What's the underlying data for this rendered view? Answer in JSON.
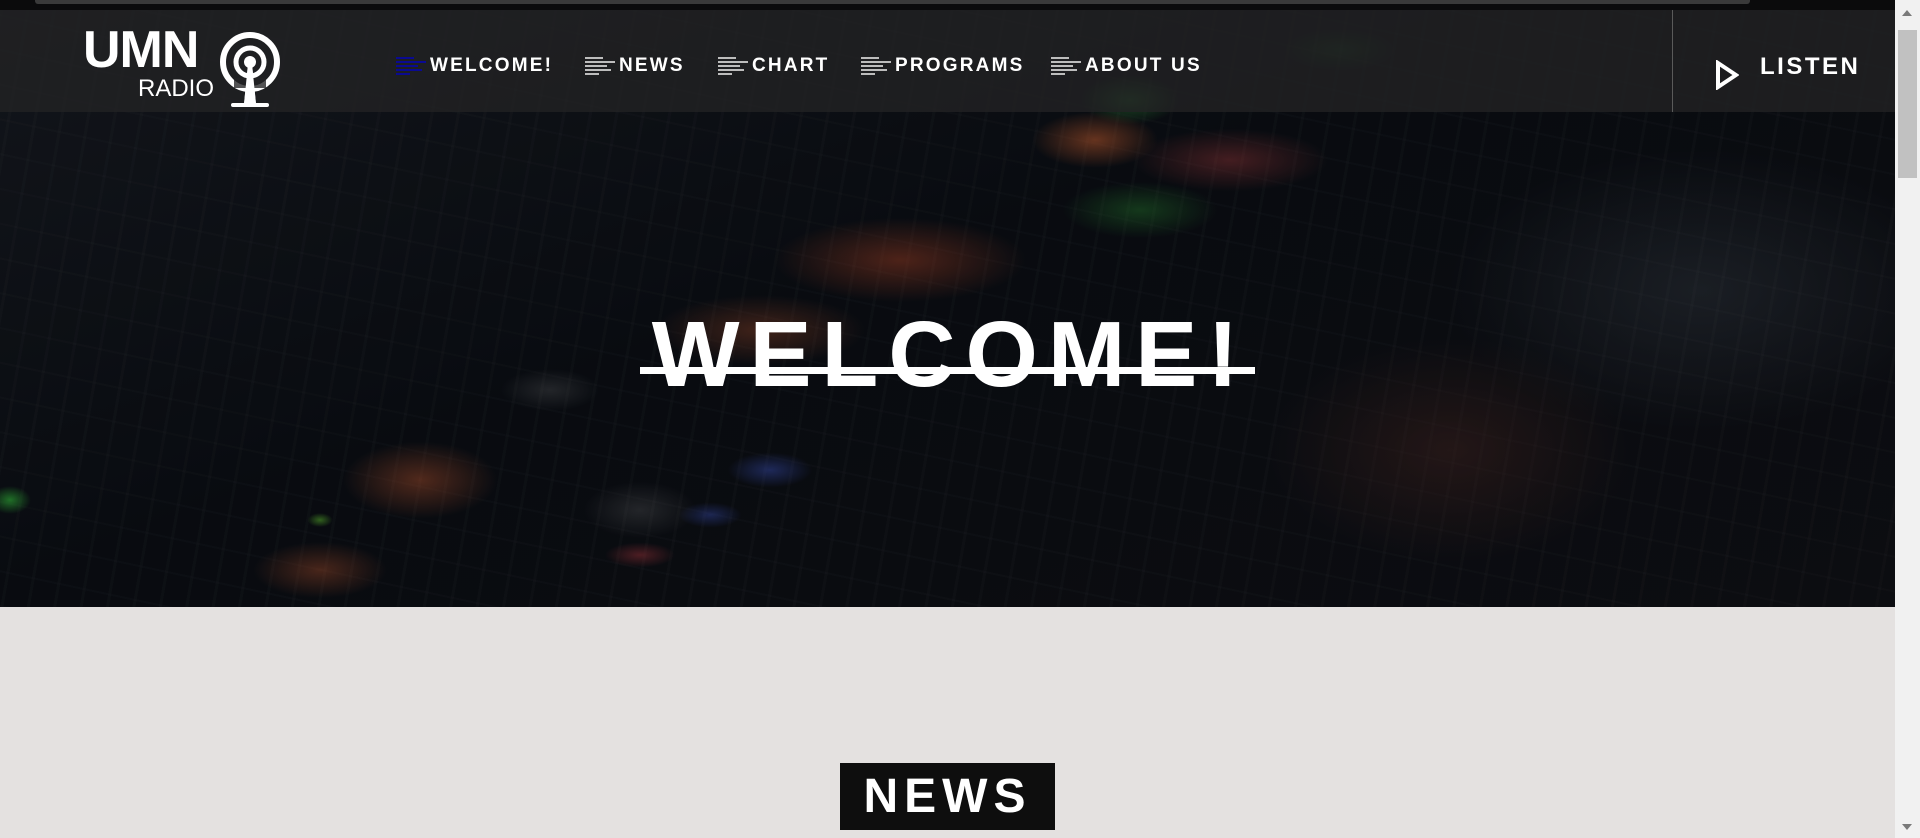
{
  "logo": {
    "brand": "UMN",
    "subbrand": "RADIO",
    "icon": "radio-antenna-icon"
  },
  "nav": {
    "items": [
      {
        "label": "WELCOME!",
        "icon": "menu-lines-icon",
        "active": true
      },
      {
        "label": "NEWS",
        "icon": "menu-lines-icon",
        "active": false
      },
      {
        "label": "CHART",
        "icon": "menu-lines-icon",
        "active": false
      },
      {
        "label": "PROGRAMS",
        "icon": "menu-lines-icon",
        "active": false
      },
      {
        "label": "ABOUT US",
        "icon": "menu-lines-icon",
        "active": false
      }
    ],
    "active_icon_color": "#0a0a92"
  },
  "listen": {
    "label": "LISTEN",
    "icon": "play-icon"
  },
  "hero": {
    "title": "WELCOME!"
  },
  "news": {
    "title": "NEWS"
  },
  "colors": {
    "background": "#e4e1e0",
    "navbar": "#222224",
    "text": "#ffffff",
    "news_badge": "#0e0e0e"
  }
}
